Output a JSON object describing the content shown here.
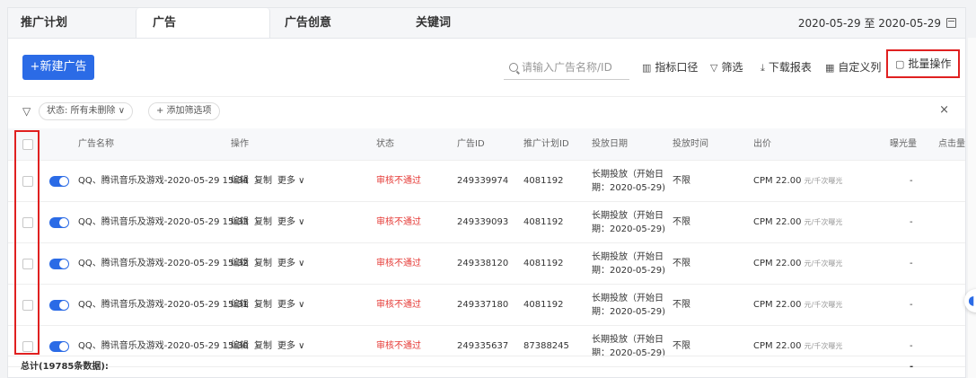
{
  "tabs": [
    {
      "label": "推广计划"
    },
    {
      "label": "广告"
    },
    {
      "label": "广告创意"
    },
    {
      "label": "关键词"
    }
  ],
  "date_range": "2020-05-29 至 2020-05-29",
  "toolbar": {
    "new_ad": "+新建广告",
    "search_placeholder": "请输入广告名称/ID",
    "metric_scope": "指标口径",
    "filter": "筛选",
    "download": "下载报表",
    "custom_columns": "自定义列",
    "batch": "批量操作"
  },
  "filter_bar": {
    "status_chip": "状态:  所有未删除 ∨",
    "add_filter": "+ 添加筛选项"
  },
  "columns": [
    "广告名称",
    "操作",
    "状态",
    "广告ID",
    "推广计划ID",
    "投放日期",
    "投放时间",
    "出价",
    "曝光量",
    "点击量"
  ],
  "row_actions": {
    "edit": "编辑",
    "copy": "复制",
    "more": "更多 ∨"
  },
  "rows": [
    {
      "name": "QQ、腾讯音乐及游戏-2020-05-29 15:34",
      "status": "审核不通过",
      "ad_id": "249339974",
      "plan_id": "4081192",
      "date_line1": "长期投放（开始日",
      "date_line2": "期：2020-05-29)",
      "time": "不限",
      "bid": "CPM 22.00",
      "bid_unit": "元/千次曝光",
      "exposure": "-"
    },
    {
      "name": "QQ、腾讯音乐及游戏-2020-05-29 15:33",
      "status": "审核不通过",
      "ad_id": "249339093",
      "plan_id": "4081192",
      "date_line1": "长期投放（开始日",
      "date_line2": "期：2020-05-29)",
      "time": "不限",
      "bid": "CPM 22.00",
      "bid_unit": "元/千次曝光",
      "exposure": "-"
    },
    {
      "name": "QQ、腾讯音乐及游戏-2020-05-29 15:32",
      "status": "审核不通过",
      "ad_id": "249338120",
      "plan_id": "4081192",
      "date_line1": "长期投放（开始日",
      "date_line2": "期：2020-05-29)",
      "time": "不限",
      "bid": "CPM 22.00",
      "bid_unit": "元/千次曝光",
      "exposure": "-"
    },
    {
      "name": "QQ、腾讯音乐及游戏-2020-05-29 15:31",
      "status": "审核不通过",
      "ad_id": "249337180",
      "plan_id": "4081192",
      "date_line1": "长期投放（开始日",
      "date_line2": "期：2020-05-29)",
      "time": "不限",
      "bid": "CPM 22.00",
      "bid_unit": "元/千次曝光",
      "exposure": "-"
    },
    {
      "name": "QQ、腾讯音乐及游戏-2020-05-29 15:30",
      "status": "审核不通过",
      "ad_id": "249335637",
      "plan_id": "87388245",
      "date_line1": "长期投放（开始日",
      "date_line2": "期：2020-05-29)",
      "time": "不限",
      "bid": "CPM 22.00",
      "bid_unit": "元/千次曝光",
      "exposure": "-"
    }
  ],
  "total": {
    "label": "总计(19785条数据):",
    "exposure": "-"
  },
  "icons": {
    "search": "search-icon",
    "metric": "chart-icon",
    "filter": "funnel-icon",
    "download": "download-icon",
    "columns": "columns-icon",
    "batch": "batch-icon",
    "calendar": "calendar-icon",
    "close": "close-icon"
  },
  "colors": {
    "primary": "#2b6be6",
    "error": "#e53935",
    "highlight": "#e02020"
  }
}
